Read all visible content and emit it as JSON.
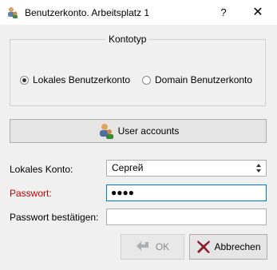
{
  "window": {
    "title": "Benutzerkonto. Arbeitsplatz 1",
    "help_label": "?",
    "close_label": "✕"
  },
  "kontotyp": {
    "legend": "Kontotyp",
    "options": [
      {
        "label": "Lokales Benutzerkonto",
        "checked": true
      },
      {
        "label": "Domain Benutzerkonto",
        "checked": false
      }
    ]
  },
  "user_accounts_button": {
    "label": "User accounts",
    "icon": "users-icon"
  },
  "form": {
    "local_account_label": "Lokales Konto:",
    "local_account_value": "Сергей",
    "password_label": "Passwort:",
    "password_value": "●●●●",
    "confirm_label": "Passwort bestätigen:",
    "confirm_value": ""
  },
  "buttons": {
    "ok_label": "OK",
    "cancel_label": "Abbrechen"
  },
  "colors": {
    "error_label": "#c00000",
    "focus_border": "#0078d7"
  }
}
